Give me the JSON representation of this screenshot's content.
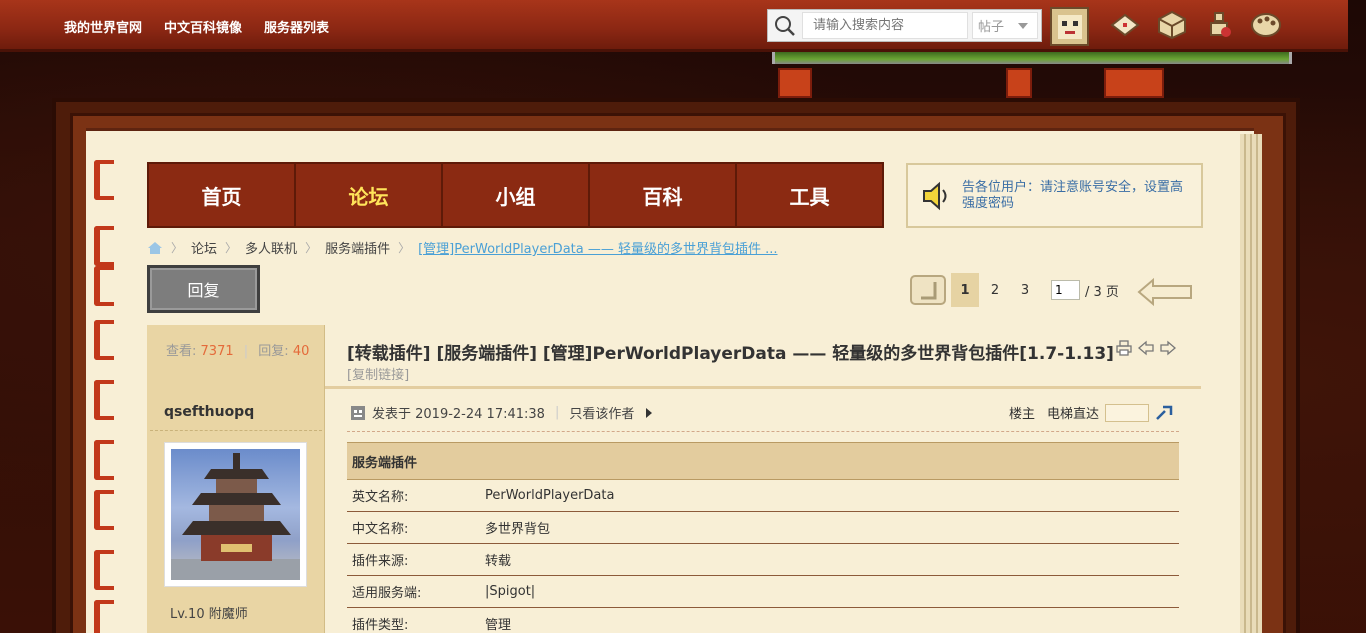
{
  "top_links": [
    "我的世界官网",
    "中文百科镜像",
    "服务器列表"
  ],
  "search": {
    "placeholder": "请输入搜索内容",
    "type": "帖子"
  },
  "main_nav": [
    {
      "label": "首页",
      "active": false
    },
    {
      "label": "论坛",
      "active": true
    },
    {
      "label": "小组",
      "active": false
    },
    {
      "label": "百科",
      "active": false
    },
    {
      "label": "工具",
      "active": false
    }
  ],
  "notice": "告各位用户：请注意账号安全，设置高强度密码",
  "breadcrumb": {
    "items": [
      "论坛",
      "多人联机",
      "服务端插件"
    ],
    "current": "[管理]PerWorldPlayerData —— 轻量级的多世界背包插件 ..."
  },
  "reply_label": "回复",
  "pager": {
    "pages": [
      "1",
      "2",
      "3"
    ],
    "current": "1",
    "input_value": "1",
    "total": "/ 3 页"
  },
  "stats": {
    "views_label": "查看:",
    "views": "7371",
    "replies_label": "回复:",
    "replies": "40"
  },
  "author": {
    "name": "qsefthuopq",
    "level": "Lv.10 附魔师"
  },
  "post": {
    "title": "[转载插件] [服务端插件] [管理]PerWorldPlayerData —— 轻量级的多世界背包插件[1.7-1.13]",
    "copy_link": "[复制链接]",
    "posted": "发表于 2019-2-24 17:41:38",
    "author_only": "只看该作者",
    "floor_label": "楼主",
    "elevator_label": "电梯直达"
  },
  "plugin_table": {
    "header": "服务端插件",
    "rows": [
      {
        "key": "英文名称:",
        "value": "PerWorldPlayerData"
      },
      {
        "key": "中文名称:",
        "value": "多世界背包"
      },
      {
        "key": "插件来源:",
        "value": "转载"
      },
      {
        "key": "适用服务端:",
        "value": "|Spigot|"
      },
      {
        "key": "插件类型:",
        "value": "管理"
      }
    ]
  },
  "colors": {
    "nav_bg": "#8b2a12",
    "nav_active": "#ffe45a",
    "link_blue": "#4aa0d6",
    "page_bg": "#f8efd6"
  }
}
